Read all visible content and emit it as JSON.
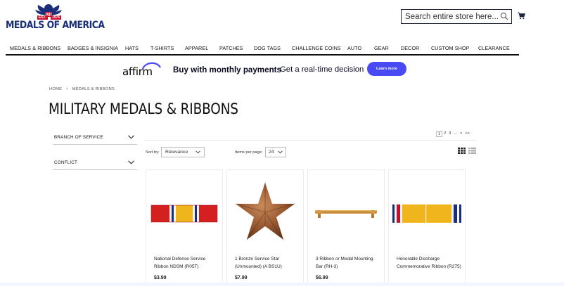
{
  "brand": {
    "name": "MEDALS OF AMERICA",
    "est": "EST.",
    "year": "1976"
  },
  "search": {
    "placeholder": "Search entire store here..."
  },
  "nav": {
    "items": [
      "MEDALS & RIBBONS",
      "BADGES & INSIGNIA",
      "HATS",
      "T-SHIRTS",
      "APPAREL",
      "PATCHES",
      "DOG TAGS",
      "CHALLENGE COINS",
      "AUTO",
      "GEAR",
      "DECOR",
      "CUSTOM SHOP",
      "CLEARANCE"
    ]
  },
  "affirm": {
    "logo": "affirm",
    "headline": "Buy with monthly payments",
    "subtext": "Get a real-time decision",
    "button": "Learn more"
  },
  "breadcrumb": {
    "home": "HOME",
    "current": "MEDALS & RIBBONS"
  },
  "page_title": "MILITARY MEDALS & RIBBONS",
  "filters": [
    {
      "label": "BRANCH OF SERVICE"
    },
    {
      "label": "CONFLICT"
    }
  ],
  "pagination": {
    "pages": [
      "1",
      "2",
      "3",
      "...",
      ">",
      ">>"
    ],
    "current": "1"
  },
  "toolbar": {
    "sort_label": "Sort by:",
    "sort_value": "Relevance",
    "per_page_label": "Items per page:",
    "per_page_value": "24"
  },
  "products": [
    {
      "name": "National Defense Service Ribbon NDSM (R05T)",
      "price": "$3.99"
    },
    {
      "name": "1 Bronze Service Star (Unmounted) (A BS1U)",
      "price": "$7.99"
    },
    {
      "name": "3 Ribbon or Medal Mounting Bar (RH-3)",
      "price": "$6.99"
    },
    {
      "name": "Honorable Discharge Commemorative Ribbon (R275)",
      "price": ""
    }
  ],
  "colors": {
    "brand_blue": "#1a2f7a",
    "brand_red": "#c8102e",
    "affirm_button": "#4a4af4"
  }
}
